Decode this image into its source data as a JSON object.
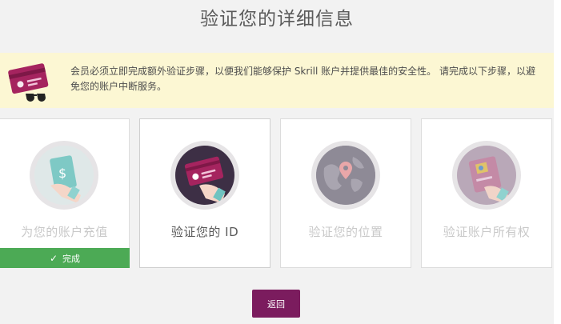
{
  "page": {
    "title": "验证您的详细信息"
  },
  "notice": {
    "icon": "credit-card-sunglasses-icon",
    "text": "会员必须立即完成额外验证步骤，以便我们能够保护 Skrill 账户并提供最佳的安全性。 请完成以下步骤，以避免您的账户中断服务。"
  },
  "steps": [
    {
      "label": "为您的账户充值",
      "icon": "deposit-money-icon",
      "status_label": "完成"
    },
    {
      "label": "验证您的 ID",
      "icon": "id-card-icon"
    },
    {
      "label": "验证您的位置",
      "icon": "globe-location-icon"
    },
    {
      "label": "验证账户所有权",
      "icon": "card-ownership-icon"
    }
  ],
  "actions": {
    "back_label": "返回"
  },
  "colors": {
    "done_green": "#4caa55",
    "brand_purple": "#7b1c5e",
    "notice_bg": "#fcf7d3"
  }
}
